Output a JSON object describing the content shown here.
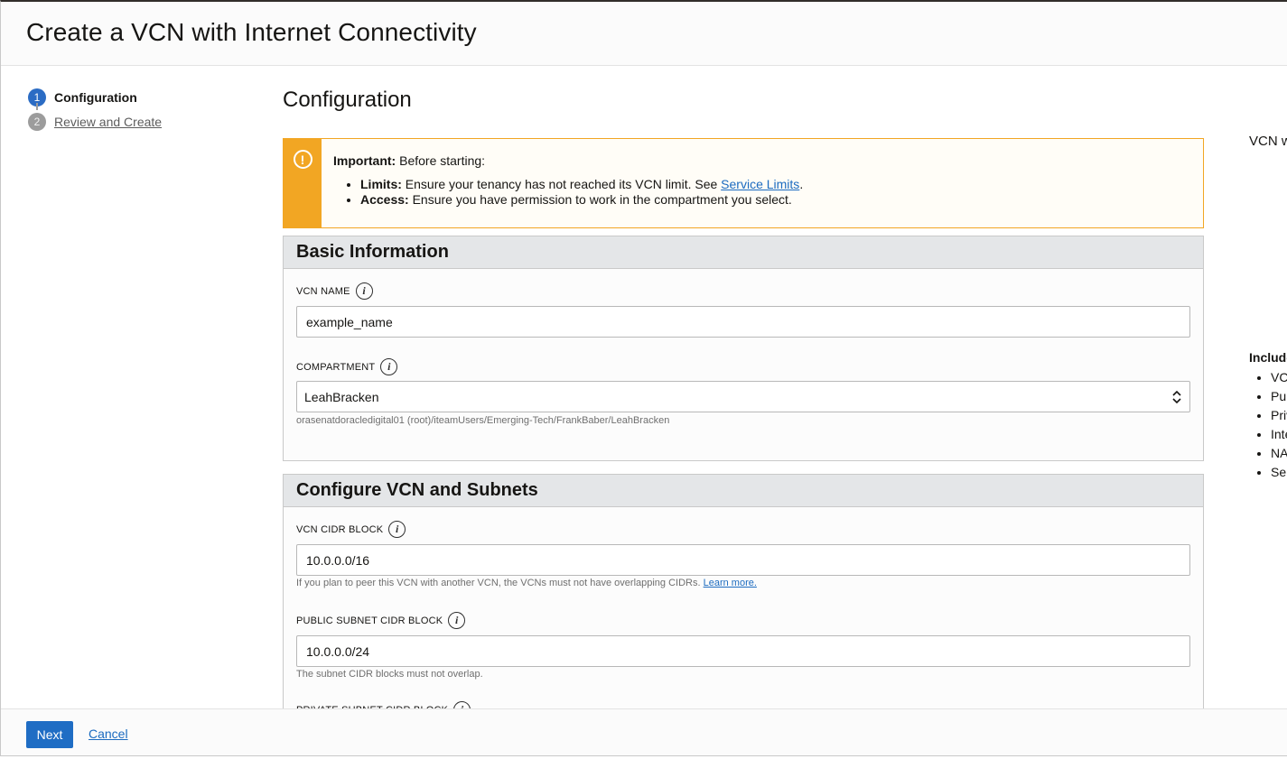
{
  "header": {
    "title": "Create a VCN with Internet Connectivity"
  },
  "steps": [
    {
      "num": "1",
      "label": "Configuration",
      "state": "active"
    },
    {
      "num": "2",
      "label": "Review and Create",
      "state": "inactive"
    }
  ],
  "main": {
    "title": "Configuration"
  },
  "alert": {
    "lead_bold": "Important:",
    "lead_text": " Before starting:",
    "items": [
      {
        "bold": "Limits:",
        "text": " Ensure your tenancy has not reached its VCN limit. See ",
        "link": "Service Limits",
        "after": "."
      },
      {
        "bold": "Access:",
        "text": " Ensure you have permission to work in the compartment you select."
      }
    ]
  },
  "basic_info": {
    "title": "Basic Information",
    "vcn_name_label": "VCN NAME",
    "vcn_name_value": "example_name",
    "compartment_label": "COMPARTMENT",
    "compartment_value": "LeahBracken",
    "compartment_path": "orasenatdoracledigital01 (root)/iteamUsers/Emerging-Tech/FrankBaber/LeahBracken"
  },
  "configure_vcn": {
    "title": "Configure VCN and Subnets",
    "vcn_cidr_label": "VCN CIDR BLOCK",
    "vcn_cidr_value": "10.0.0.0/16",
    "vcn_cidr_help": "If you plan to peer this VCN with another VCN, the VCNs must not have overlapping CIDRs. ",
    "vcn_cidr_help_link": "Learn more.",
    "public_subnet_label": "PUBLIC SUBNET CIDR BLOCK",
    "public_subnet_value": "10.0.0.0/24",
    "public_subnet_help": "The subnet CIDR blocks must not overlap.",
    "private_subnet_label": "PRIVATE SUBNET CIDR BLOCK"
  },
  "right_panel": {
    "title": "VCN w",
    "includes": "Include",
    "items": [
      "VC",
      "Pul",
      "Priv",
      "Inte",
      "NA",
      "Ser"
    ]
  },
  "footer": {
    "next_label": "Next",
    "cancel_label": "Cancel"
  },
  "colors": {
    "primary": "#1f6dc4",
    "warning": "#f2a623",
    "link": "#1b6bc0"
  }
}
